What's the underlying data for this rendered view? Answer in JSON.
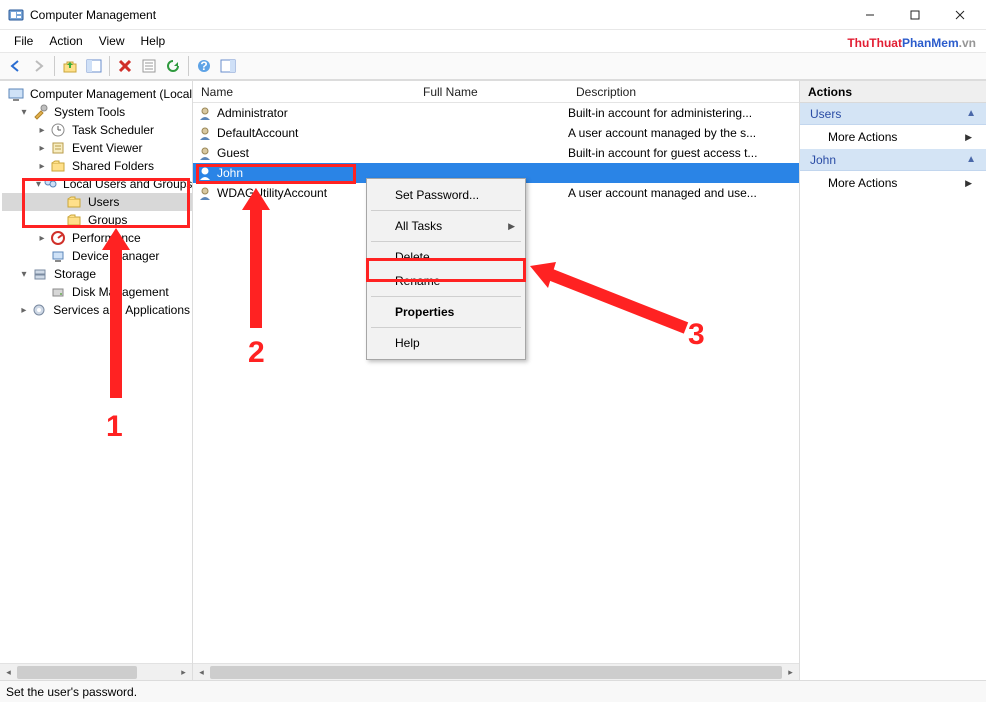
{
  "window": {
    "title": "Computer Management",
    "status": "Set the user's password."
  },
  "menus": {
    "file": "File",
    "action": "Action",
    "view": "View",
    "help": "Help"
  },
  "watermark": {
    "a": "ThuThuat",
    "b": "PhanMem",
    "c": ".vn"
  },
  "tree": {
    "root": "Computer Management (Local)",
    "system_tools": "System Tools",
    "task_sched": "Task Scheduler",
    "event_viewer": "Event Viewer",
    "shared_folders": "Shared Folders",
    "lug": "Local Users and Groups",
    "users": "Users",
    "groups": "Groups",
    "performance": "Performance",
    "device_mgr": "Device Manager",
    "storage": "Storage",
    "disk_mgmt": "Disk Management",
    "services_apps": "Services and Applications"
  },
  "list": {
    "col_name": "Name",
    "col_full": "Full Name",
    "col_desc": "Description",
    "rows": [
      {
        "name": "Administrator",
        "full": "",
        "desc": "Built-in account for administering..."
      },
      {
        "name": "DefaultAccount",
        "full": "",
        "desc": "A user account managed by the s..."
      },
      {
        "name": "Guest",
        "full": "",
        "desc": "Built-in account for guest access t..."
      },
      {
        "name": "John",
        "full": "",
        "desc": ""
      },
      {
        "name": "WDAGUtilityAccount",
        "full": "",
        "desc": "A user account managed and use..."
      }
    ]
  },
  "context_menu": {
    "set_password": "Set Password...",
    "all_tasks": "All Tasks",
    "delete": "Delete",
    "rename": "Rename",
    "properties": "Properties",
    "help": "Help"
  },
  "actions": {
    "header": "Actions",
    "group1": "Users",
    "more1": "More Actions",
    "group2": "John",
    "more2": "More Actions"
  },
  "anno": {
    "n1": "1",
    "n2": "2",
    "n3": "3"
  }
}
